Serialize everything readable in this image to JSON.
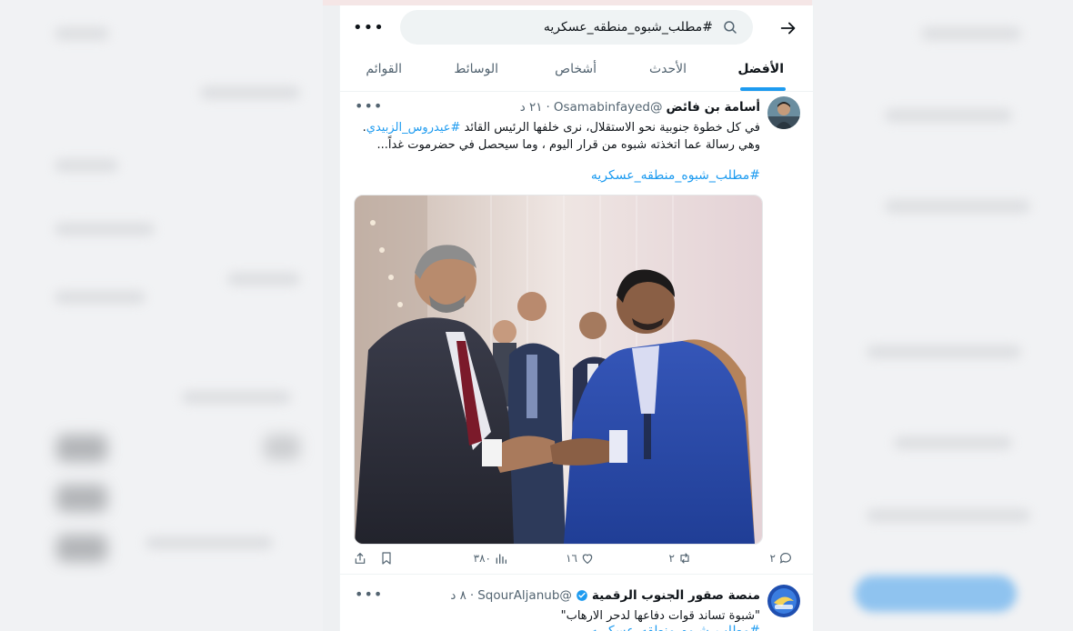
{
  "search": {
    "query": "#مطلب_شبوه_منطقه_عسكريه"
  },
  "tabs": [
    {
      "label": "الأفضل",
      "active": true
    },
    {
      "label": "الأحدث",
      "active": false
    },
    {
      "label": "أشخاص",
      "active": false
    },
    {
      "label": "الوسائط",
      "active": false
    },
    {
      "label": "القوائم",
      "active": false
    }
  ],
  "tweets": [
    {
      "name": "أسامة بن فائض",
      "handle": "@Osamabinfayed",
      "dot": "·",
      "time": "٢١ د",
      "text_part1": "في كل خطوة جنوبية نحو الاستقلال، نرى خلفها الرئيس القائد ",
      "text_mention": "#عيدروس_الزبيدي",
      "text_part2": ".",
      "text_line2": "وهي رسالة عما اتخذته شبوه من قرار اليوم ، وما سيحصل في حضرموت غداً...",
      "hashtag": "#مطلب_شبوه_منطقه_عسكريه",
      "replies": "٢",
      "retweets": "٢",
      "likes": "١٦",
      "views": "٣٨٠"
    },
    {
      "name": "منصة صقور الجنوب الرقمية",
      "handle": "@SqourAljanub",
      "dot": "·",
      "time": "٨ د",
      "text": "\"شبوة تساند قوات دفاعها لدحر الارهاب\"",
      "hashtag": "#مطلب_شبوه_منطقه_عسكريه"
    }
  ],
  "colors": {
    "accent": "#1d9bf0",
    "secondary_text": "#536471",
    "primary_text": "#0f1419"
  },
  "icons": [
    "back-arrow-icon",
    "search-icon",
    "more-icon",
    "reply-icon",
    "retweet-icon",
    "like-icon",
    "views-icon",
    "bookmark-icon",
    "share-icon",
    "verified-badge-icon"
  ]
}
